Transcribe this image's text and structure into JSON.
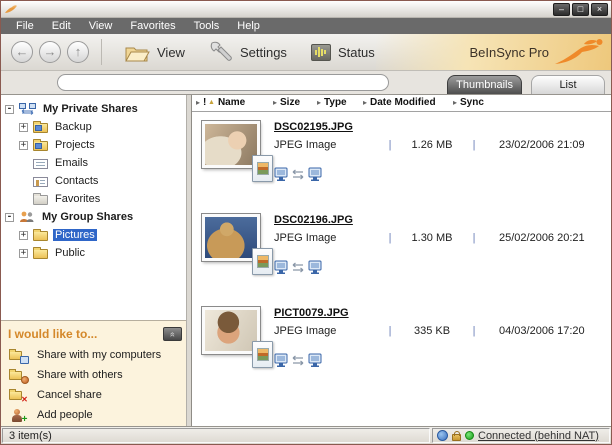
{
  "window": {
    "controls": {
      "minimize": "–",
      "maximize": "□",
      "close": "×"
    }
  },
  "menu": {
    "items": [
      "File",
      "Edit",
      "View",
      "Favorites",
      "Tools",
      "Help"
    ]
  },
  "toolbar": {
    "icons": {
      "back": "←",
      "forward": "→",
      "up": "↑"
    },
    "view_label": "View",
    "settings_label": "Settings",
    "status_label": "Status",
    "brand": "BeInSync Pro",
    "brand_orange": "#ef8a2a"
  },
  "addressbar": {
    "value": ""
  },
  "tabs": {
    "thumbnails": "Thumbnails",
    "list": "List"
  },
  "tree": {
    "private": {
      "label": "My Private Shares",
      "expand": "-",
      "children": [
        {
          "label": "Backup",
          "expand": "+"
        },
        {
          "label": "Projects",
          "expand": "+"
        },
        {
          "label": "Emails"
        },
        {
          "label": "Contacts"
        },
        {
          "label": "Favorites"
        }
      ]
    },
    "group": {
      "label": "My Group Shares",
      "expand": "-",
      "children": [
        {
          "label": "Pictures",
          "expand": "+",
          "selected": true
        },
        {
          "label": "Public",
          "expand": "+"
        }
      ]
    },
    "selection_color": "#2f66c8"
  },
  "tasks": {
    "title": "I would like to...",
    "collapse_glyph": "«",
    "items": [
      "Share with my computers",
      "Share with others",
      "Cancel share",
      "Add people"
    ],
    "badge_glyphs": {
      "cancel": "✕",
      "add": "+"
    },
    "title_color": "#d4882a"
  },
  "columns": {
    "bullet": "▸",
    "sort_asc": "▲",
    "alert": "!",
    "name": "Name",
    "size": "Size",
    "type": "Type",
    "date_modified": "Date Modified",
    "sync": "Sync"
  },
  "files": [
    {
      "name": "DSC02195.JPG",
      "type": "JPEG Image",
      "size": "1.26 MB",
      "date": "23/02/2006 21:09"
    },
    {
      "name": "DSC02196.JPG",
      "type": "JPEG Image",
      "size": "1.30 MB",
      "date": "25/02/2006 20:21"
    },
    {
      "name": "PICT0079.JPG",
      "type": "JPEG Image",
      "size": "335 KB",
      "date": "04/03/2006 17:20"
    }
  ],
  "files_meta": {
    "separator": "|"
  },
  "statusbar": {
    "items_count": "3 item(s)",
    "connection_status": "Connected (behind NAT)",
    "connected_color": "#1a9a1a"
  }
}
